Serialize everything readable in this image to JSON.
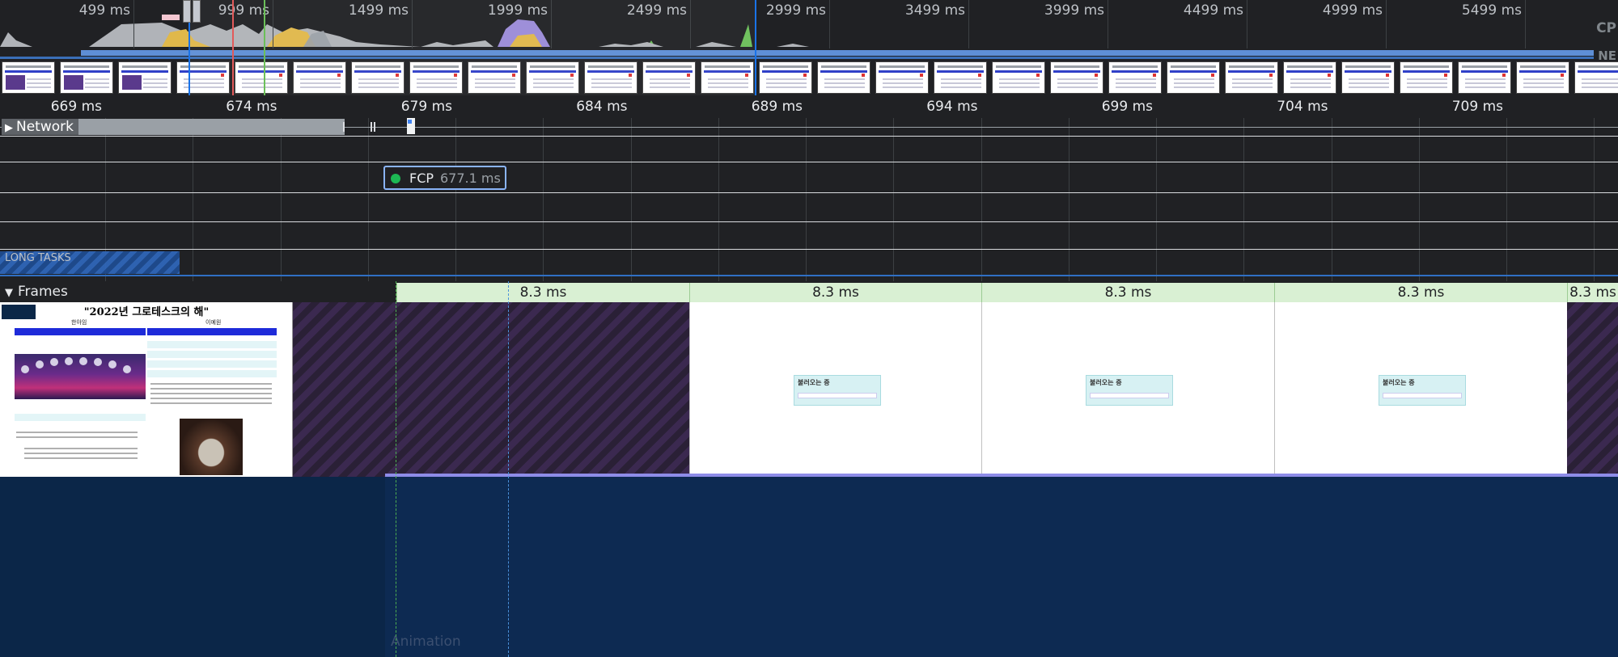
{
  "overview": {
    "tick_labels": [
      "499 ms",
      "999 ms",
      "1499 ms",
      "1999 ms",
      "2499 ms",
      "2999 ms",
      "3499 ms",
      "3999 ms",
      "4499 ms",
      "4999 ms",
      "5499 ms"
    ],
    "cpu_label": "CP",
    "net_label": "NE"
  },
  "ruler": {
    "labels": [
      "669 ms",
      "674 ms",
      "679 ms",
      "684 ms",
      "689 ms",
      "694 ms",
      "699 ms",
      "704 ms",
      "709 ms"
    ]
  },
  "tracks": {
    "network_label": "Network",
    "fcp": {
      "label": "FCP",
      "time": "677.1 ms"
    },
    "long_tasks_label": "LONG TASKS"
  },
  "frames": {
    "label": "Frames",
    "durations": [
      "8.3 ms",
      "8.3 ms",
      "8.3 ms",
      "8.3 ms",
      "8.3 ms"
    ],
    "loading_text": "불러오는 중",
    "page_screenshot": {
      "title": "\"2022년 그로테스크의 해\"",
      "col_left": "한아임",
      "col_right": "이예원"
    }
  },
  "main": {
    "animation_label": "Animation"
  },
  "colors": {
    "background": "#202124",
    "fcp_green": "#1db954",
    "selection_blue": "#8ab4f8",
    "frame_green": "#d9f0d3",
    "main_blue": "#0d2a52"
  }
}
